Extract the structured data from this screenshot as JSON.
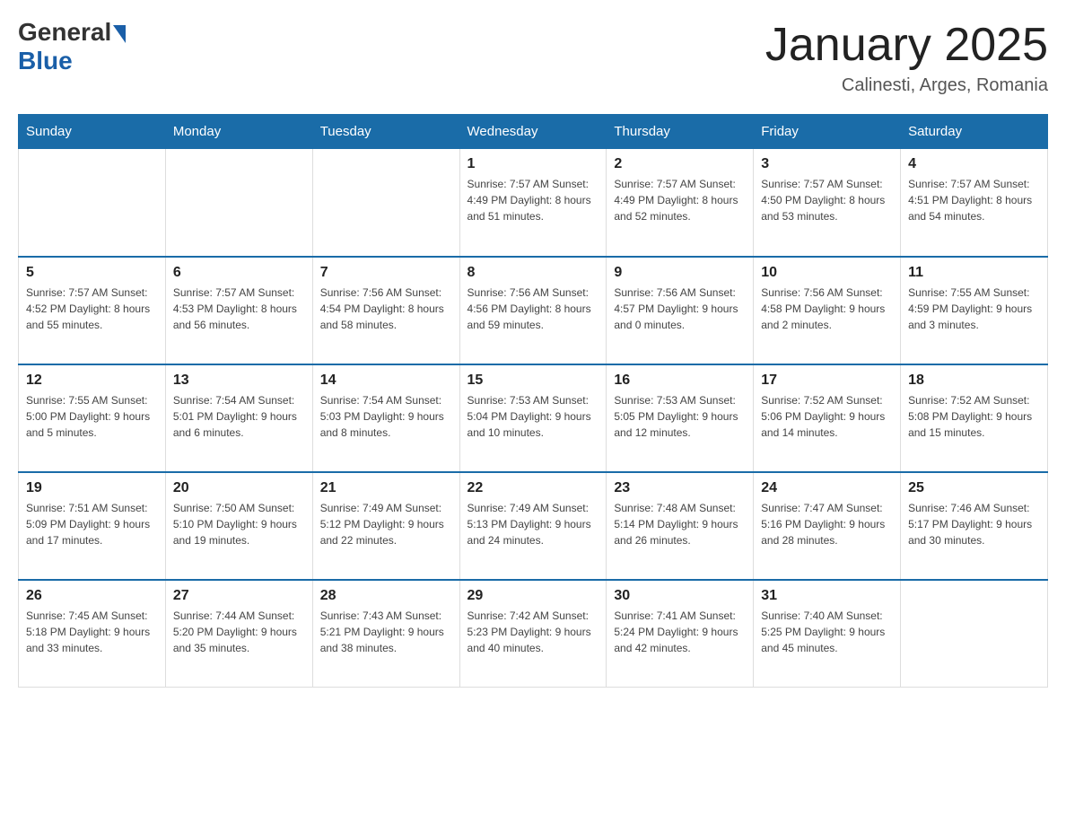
{
  "header": {
    "logo_general": "General",
    "logo_blue": "Blue",
    "month_title": "January 2025",
    "location": "Calinesti, Arges, Romania"
  },
  "days_of_week": [
    "Sunday",
    "Monday",
    "Tuesday",
    "Wednesday",
    "Thursday",
    "Friday",
    "Saturday"
  ],
  "weeks": [
    {
      "days": [
        {
          "number": "",
          "info": ""
        },
        {
          "number": "",
          "info": ""
        },
        {
          "number": "",
          "info": ""
        },
        {
          "number": "1",
          "info": "Sunrise: 7:57 AM\nSunset: 4:49 PM\nDaylight: 8 hours and 51 minutes."
        },
        {
          "number": "2",
          "info": "Sunrise: 7:57 AM\nSunset: 4:49 PM\nDaylight: 8 hours and 52 minutes."
        },
        {
          "number": "3",
          "info": "Sunrise: 7:57 AM\nSunset: 4:50 PM\nDaylight: 8 hours and 53 minutes."
        },
        {
          "number": "4",
          "info": "Sunrise: 7:57 AM\nSunset: 4:51 PM\nDaylight: 8 hours and 54 minutes."
        }
      ]
    },
    {
      "days": [
        {
          "number": "5",
          "info": "Sunrise: 7:57 AM\nSunset: 4:52 PM\nDaylight: 8 hours and 55 minutes."
        },
        {
          "number": "6",
          "info": "Sunrise: 7:57 AM\nSunset: 4:53 PM\nDaylight: 8 hours and 56 minutes."
        },
        {
          "number": "7",
          "info": "Sunrise: 7:56 AM\nSunset: 4:54 PM\nDaylight: 8 hours and 58 minutes."
        },
        {
          "number": "8",
          "info": "Sunrise: 7:56 AM\nSunset: 4:56 PM\nDaylight: 8 hours and 59 minutes."
        },
        {
          "number": "9",
          "info": "Sunrise: 7:56 AM\nSunset: 4:57 PM\nDaylight: 9 hours and 0 minutes."
        },
        {
          "number": "10",
          "info": "Sunrise: 7:56 AM\nSunset: 4:58 PM\nDaylight: 9 hours and 2 minutes."
        },
        {
          "number": "11",
          "info": "Sunrise: 7:55 AM\nSunset: 4:59 PM\nDaylight: 9 hours and 3 minutes."
        }
      ]
    },
    {
      "days": [
        {
          "number": "12",
          "info": "Sunrise: 7:55 AM\nSunset: 5:00 PM\nDaylight: 9 hours and 5 minutes."
        },
        {
          "number": "13",
          "info": "Sunrise: 7:54 AM\nSunset: 5:01 PM\nDaylight: 9 hours and 6 minutes."
        },
        {
          "number": "14",
          "info": "Sunrise: 7:54 AM\nSunset: 5:03 PM\nDaylight: 9 hours and 8 minutes."
        },
        {
          "number": "15",
          "info": "Sunrise: 7:53 AM\nSunset: 5:04 PM\nDaylight: 9 hours and 10 minutes."
        },
        {
          "number": "16",
          "info": "Sunrise: 7:53 AM\nSunset: 5:05 PM\nDaylight: 9 hours and 12 minutes."
        },
        {
          "number": "17",
          "info": "Sunrise: 7:52 AM\nSunset: 5:06 PM\nDaylight: 9 hours and 14 minutes."
        },
        {
          "number": "18",
          "info": "Sunrise: 7:52 AM\nSunset: 5:08 PM\nDaylight: 9 hours and 15 minutes."
        }
      ]
    },
    {
      "days": [
        {
          "number": "19",
          "info": "Sunrise: 7:51 AM\nSunset: 5:09 PM\nDaylight: 9 hours and 17 minutes."
        },
        {
          "number": "20",
          "info": "Sunrise: 7:50 AM\nSunset: 5:10 PM\nDaylight: 9 hours and 19 minutes."
        },
        {
          "number": "21",
          "info": "Sunrise: 7:49 AM\nSunset: 5:12 PM\nDaylight: 9 hours and 22 minutes."
        },
        {
          "number": "22",
          "info": "Sunrise: 7:49 AM\nSunset: 5:13 PM\nDaylight: 9 hours and 24 minutes."
        },
        {
          "number": "23",
          "info": "Sunrise: 7:48 AM\nSunset: 5:14 PM\nDaylight: 9 hours and 26 minutes."
        },
        {
          "number": "24",
          "info": "Sunrise: 7:47 AM\nSunset: 5:16 PM\nDaylight: 9 hours and 28 minutes."
        },
        {
          "number": "25",
          "info": "Sunrise: 7:46 AM\nSunset: 5:17 PM\nDaylight: 9 hours and 30 minutes."
        }
      ]
    },
    {
      "days": [
        {
          "number": "26",
          "info": "Sunrise: 7:45 AM\nSunset: 5:18 PM\nDaylight: 9 hours and 33 minutes."
        },
        {
          "number": "27",
          "info": "Sunrise: 7:44 AM\nSunset: 5:20 PM\nDaylight: 9 hours and 35 minutes."
        },
        {
          "number": "28",
          "info": "Sunrise: 7:43 AM\nSunset: 5:21 PM\nDaylight: 9 hours and 38 minutes."
        },
        {
          "number": "29",
          "info": "Sunrise: 7:42 AM\nSunset: 5:23 PM\nDaylight: 9 hours and 40 minutes."
        },
        {
          "number": "30",
          "info": "Sunrise: 7:41 AM\nSunset: 5:24 PM\nDaylight: 9 hours and 42 minutes."
        },
        {
          "number": "31",
          "info": "Sunrise: 7:40 AM\nSunset: 5:25 PM\nDaylight: 9 hours and 45 minutes."
        },
        {
          "number": "",
          "info": ""
        }
      ]
    }
  ]
}
